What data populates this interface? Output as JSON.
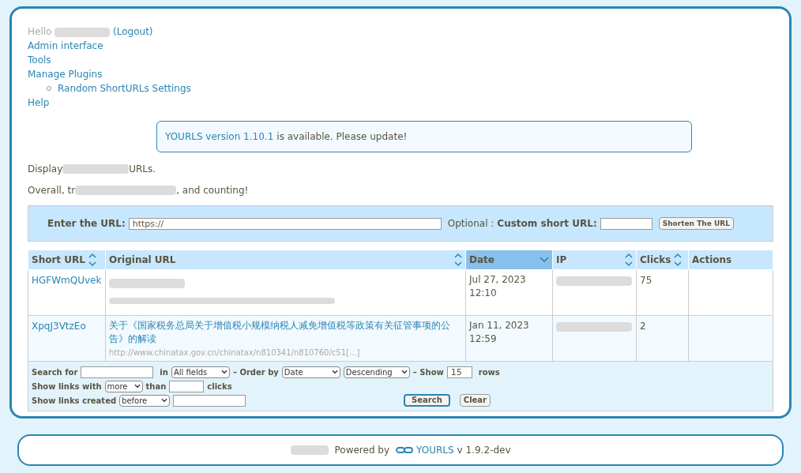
{
  "user_menu": {
    "greeting": "Hello",
    "logout": "(Logout)",
    "items": [
      {
        "label": "Admin interface"
      },
      {
        "label": "Tools"
      },
      {
        "label": "Manage Plugins",
        "children": [
          {
            "label": "Random ShortURLs Settings"
          }
        ]
      },
      {
        "label": "Help"
      }
    ]
  },
  "notice": {
    "link": "YOURLS version 1.10.1",
    "text": "is available. Please update!"
  },
  "stats": {
    "display_before": "Display",
    "display_after": "URLs.",
    "overall_before": "Overall, tr",
    "overall_after": ", and counting!"
  },
  "new_url": {
    "url_label": "Enter the URL:",
    "url_value": "https://",
    "optional": "Optional :",
    "custom_label": "Custom short URL:",
    "button": "Shorten The URL"
  },
  "table": {
    "columns": [
      {
        "label": "Short URL",
        "sortable": true,
        "selected": false
      },
      {
        "label": "Original URL",
        "sortable": true,
        "selected": false
      },
      {
        "label": "Date",
        "sortable": true,
        "selected": true
      },
      {
        "label": "IP",
        "sortable": true,
        "selected": false
      },
      {
        "label": "Clicks",
        "sortable": true,
        "selected": false
      },
      {
        "label": "Actions",
        "sortable": false,
        "selected": false
      }
    ],
    "rows": [
      {
        "short": "HGFWmQUvek",
        "title": "",
        "url": "",
        "date": "Jul 27, 2023",
        "time": "12:10",
        "clicks": "75"
      },
      {
        "short": "XpqJ3VtzEo",
        "title": "关于《国家税务总局关于增值税小规模纳税人减免增值税等政策有关征管事项的公告》的解读",
        "url": "http://www.chinatax.gov.cn/chinatax/n810341/n810760/c51[...]",
        "date": "Jan 11, 2023",
        "time": "12:59",
        "clicks": "2"
      }
    ]
  },
  "filter": {
    "search_for": "Search for",
    "in": "in",
    "field": "All fields",
    "order_by": "– Order by",
    "order_field": "Date",
    "order_dir": "Descending",
    "show": "– Show",
    "show_count": "15",
    "rows": "rows",
    "links_with": "Show links with",
    "more": "more",
    "than": "than",
    "clicks": "clicks",
    "links_created": "Show links created",
    "before": "before",
    "search": "Search",
    "clear": "Clear"
  },
  "footer": {
    "powered": "Powered by",
    "brand": "YOURLS",
    "version": "v 1.9.2-dev"
  }
}
